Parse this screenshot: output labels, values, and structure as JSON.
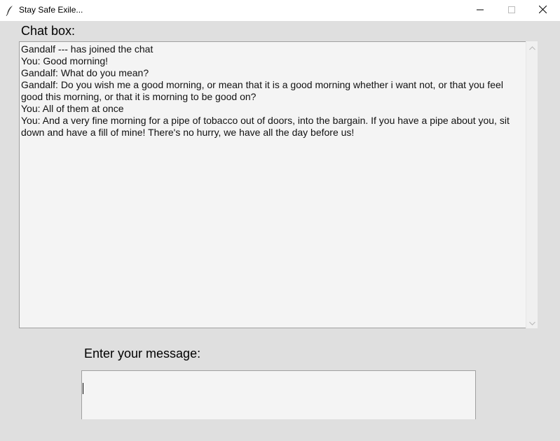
{
  "window": {
    "title": "Stay Safe Exile...",
    "icon": "feather-icon",
    "controls": [
      "minimize-icon",
      "maximize-icon",
      "close-icon"
    ]
  },
  "chat": {
    "label": "Chat box:",
    "lines": [
      "Gandalf  --- has joined the chat",
      "You: Good morning!",
      "Gandalf: What do you mean?",
      "Gandalf: Do you wish me a good morning, or mean that it is a good morning whether i want not, or that you feel good this morning, or that it is morning to be good on?",
      "You: All of them at once",
      "You: And a very fine morning for a pipe of tobacco out of doors, into the bargain. If you have a pipe about you, sit down and have a fill of mine! There's no hurry, we have all the day before us!"
    ]
  },
  "message": {
    "label": "Enter your message:",
    "value": ""
  },
  "colors": {
    "window_bg": "#dfdfdf",
    "field_bg": "#f4f4f4",
    "titlebar_bg": "#ffffff"
  }
}
